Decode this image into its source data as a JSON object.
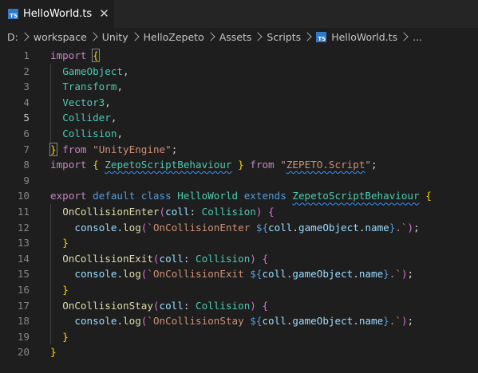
{
  "tab": {
    "icon_label": "TS",
    "title": "HelloWorld.ts",
    "close_glyph": "✕"
  },
  "breadcrumb": {
    "items": [
      "D:",
      "workspace",
      "Unity",
      "HelloZepeto",
      "Assets",
      "Scripts",
      "HelloWorld.ts",
      "..."
    ]
  },
  "editor": {
    "active_line": 5,
    "lines": [
      {
        "n": "1",
        "code": "import {"
      },
      {
        "n": "2",
        "code": "  GameObject,"
      },
      {
        "n": "3",
        "code": "  Transform,"
      },
      {
        "n": "4",
        "code": "  Vector3,"
      },
      {
        "n": "5",
        "code": "  Collider,"
      },
      {
        "n": "6",
        "code": "  Collision,"
      },
      {
        "n": "7",
        "code": "} from \"UnityEngine\";"
      },
      {
        "n": "8",
        "code": "import { ZepetoScriptBehaviour } from \"ZEPETO.Script\";"
      },
      {
        "n": "9",
        "code": ""
      },
      {
        "n": "10",
        "code": "export default class HelloWorld extends ZepetoScriptBehaviour {"
      },
      {
        "n": "11",
        "code": "  OnCollisionEnter(coll: Collision) {"
      },
      {
        "n": "12",
        "code": "    console.log(`OnCollisionEnter ${coll.gameObject.name}.`);"
      },
      {
        "n": "13",
        "code": "  }"
      },
      {
        "n": "14",
        "code": "  OnCollisionExit(coll: Collision) {"
      },
      {
        "n": "15",
        "code": "    console.log(`OnCollisionExit ${coll.gameObject.name}.`);"
      },
      {
        "n": "16",
        "code": "  }"
      },
      {
        "n": "17",
        "code": "  OnCollisionStay(coll: Collision) {"
      },
      {
        "n": "18",
        "code": "    console.log(`OnCollisionStay ${coll.gameObject.name}.`);"
      },
      {
        "n": "19",
        "code": "  }"
      },
      {
        "n": "20",
        "code": "}"
      }
    ]
  },
  "colors": {
    "editor_bg": "#1e1e1e",
    "tabbar_bg": "#252526",
    "ts_badge": "#3178c6",
    "keyword_blue": "#569cd6",
    "keyword_purple": "#c586c0",
    "variable": "#9cdcfe",
    "class_type": "#4ec9b0",
    "function": "#dcdcaa",
    "string": "#ce9178",
    "bracket_gold": "#ffd700",
    "bracket_orchid": "#da70d6",
    "bracket_blue": "#179fff"
  }
}
